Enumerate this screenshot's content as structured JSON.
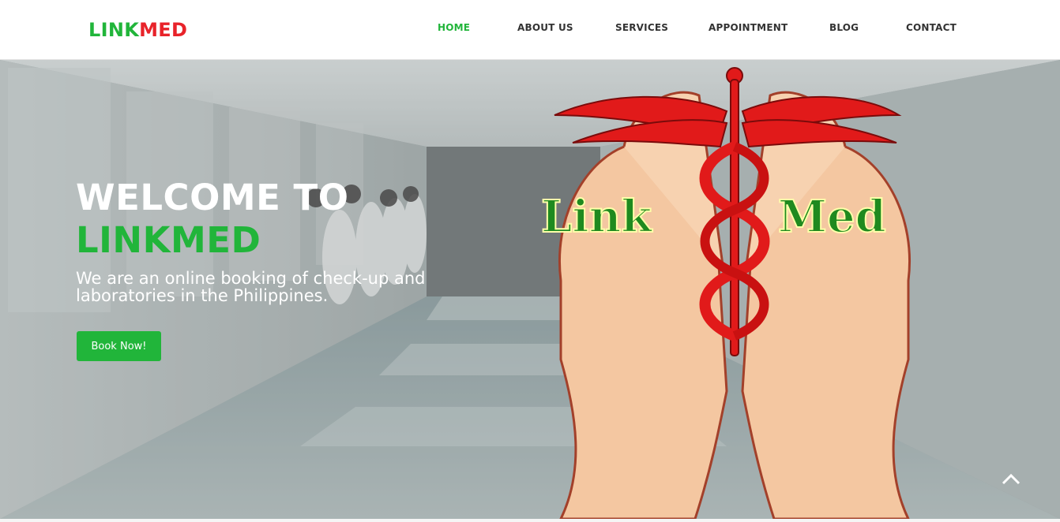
{
  "brand": {
    "part1": "LINK",
    "part2": "MED",
    "color_green": "#21b53a",
    "color_red": "#e8232a"
  },
  "nav": {
    "items": [
      {
        "label": "HOME",
        "active": true
      },
      {
        "label": "ABOUT US",
        "active": false
      },
      {
        "label": "SERVICES",
        "active": false
      },
      {
        "label": "APPOINTMENT",
        "active": false
      },
      {
        "label": "BLOG",
        "active": false
      },
      {
        "label": "CONTACT",
        "active": false
      }
    ]
  },
  "hero": {
    "title_line1": "WELCOME TO",
    "title_line2": "LINKMED",
    "subtitle": "We are an online booking of check-up and laboratories in the Philippines.",
    "cta_label": "Book Now!",
    "logo_word1": "Link",
    "logo_word2": "Med"
  },
  "icons": {
    "scroll_top": "chevron-up-icon",
    "caduceus": "caduceus-icon"
  }
}
